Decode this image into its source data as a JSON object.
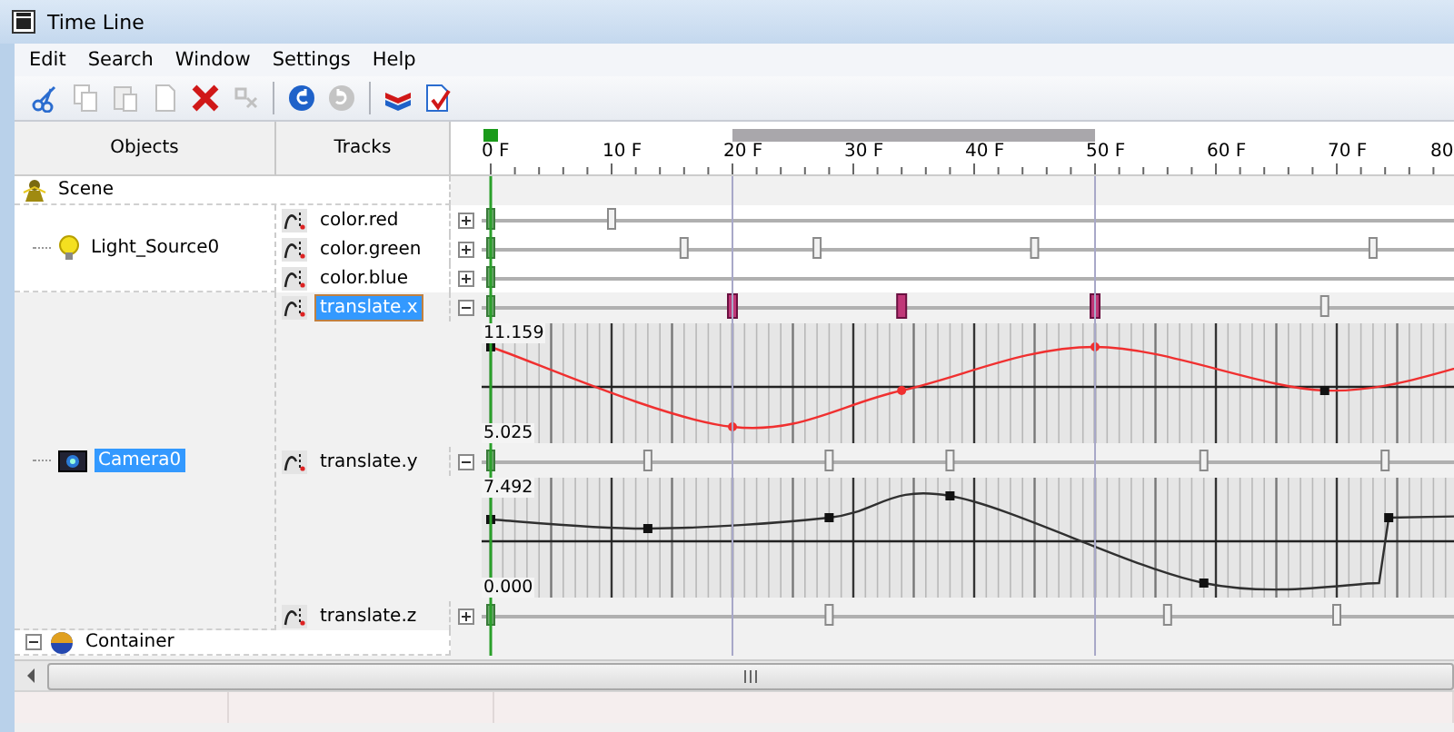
{
  "window": {
    "title": "Time Line"
  },
  "menu": [
    "Edit",
    "Search",
    "Window",
    "Settings",
    "Help"
  ],
  "toolbar": [
    {
      "kind": "cut",
      "disabled": false
    },
    {
      "kind": "copy",
      "disabled": true
    },
    {
      "kind": "paste",
      "disabled": true
    },
    {
      "kind": "new",
      "disabled": true
    },
    {
      "kind": "delete",
      "disabled": false
    },
    {
      "kind": "remove",
      "disabled": true
    },
    {
      "kind": "separator"
    },
    {
      "kind": "undo",
      "disabled": false
    },
    {
      "kind": "redo",
      "disabled": true
    },
    {
      "kind": "separator"
    },
    {
      "kind": "layers",
      "disabled": false
    },
    {
      "kind": "check",
      "disabled": false
    }
  ],
  "headers": {
    "objects": "Objects",
    "tracks": "Tracks"
  },
  "ruler": {
    "labels": [
      "0 F",
      "10 F",
      "20 F",
      "30 F",
      "40 F",
      "50 F",
      "60 F",
      "70 F",
      "80"
    ]
  },
  "scene": {
    "name": "Scene",
    "children": [
      {
        "name": "Light_Source0",
        "kind": "light",
        "selected": false,
        "tracks": [
          {
            "name": "color.red",
            "selected": false,
            "expanded": false
          },
          {
            "name": "color.green",
            "selected": false,
            "expanded": false
          },
          {
            "name": "color.blue",
            "selected": false,
            "expanded": false
          }
        ]
      },
      {
        "name": "Camera0",
        "kind": "camera",
        "selected": true,
        "tracks": [
          {
            "name": "translate.x",
            "selected": true,
            "expanded": true,
            "graph": {
              "max": "11.159",
              "min": "5.025"
            }
          },
          {
            "name": "translate.y",
            "selected": false,
            "expanded": true,
            "graph": {
              "max": "7.492",
              "min": "0.000"
            }
          },
          {
            "name": "translate.z",
            "selected": false,
            "expanded": false
          }
        ]
      },
      {
        "name": "Container",
        "kind": "container",
        "selected": false,
        "expanded": true
      }
    ]
  }
}
